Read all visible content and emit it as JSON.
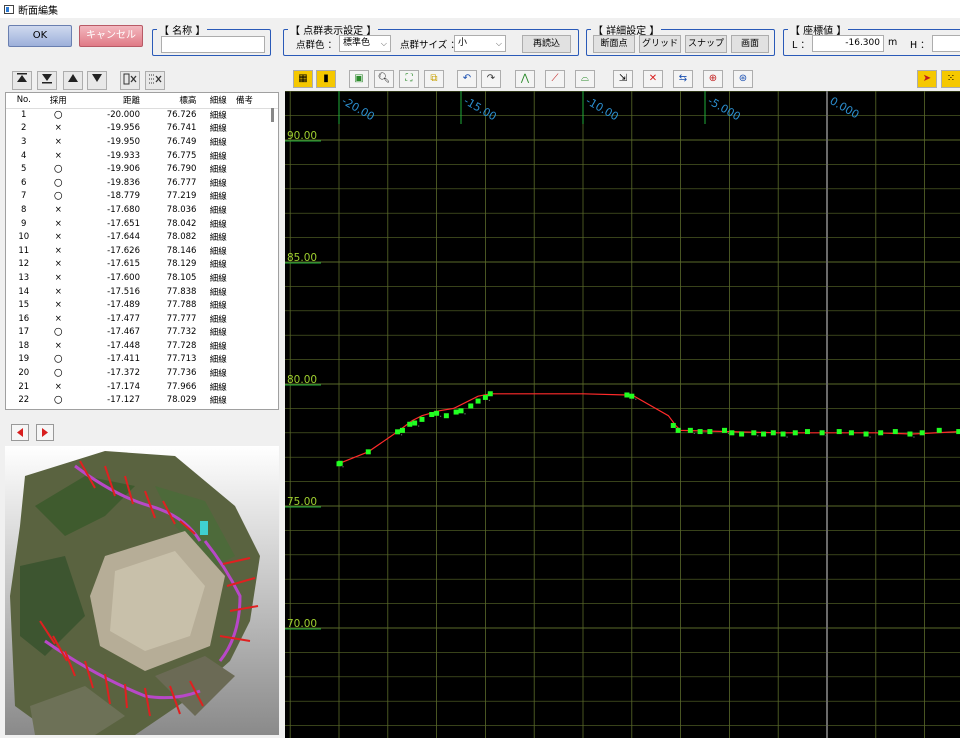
{
  "window": {
    "title": "断面編集"
  },
  "buttons": {
    "ok": "OK",
    "cancel": "キャンセル"
  },
  "name_group": {
    "title": "【 名称 】",
    "value": ""
  },
  "display_group": {
    "title": "【 点群表示設定 】",
    "color_label": "点群色 ：",
    "color_value": "標準色",
    "size_label": "点群サイズ ：",
    "size_value": "小",
    "reload": "再読込"
  },
  "detail_group": {
    "title": "【 詳細設定 】",
    "buttons": [
      "断面点",
      "グリッド",
      "スナップ",
      "画面"
    ]
  },
  "coord_group": {
    "title": "【 座標値 】",
    "l_label": "L ：",
    "l_value": "-16.300",
    "l_unit": "m",
    "h_label": "H ："
  },
  "table": {
    "headers": [
      "No.",
      "採用",
      "距離",
      "標高",
      "細線",
      "備考"
    ],
    "rows": [
      [
        "1",
        "〇",
        "-20.000",
        "76.726",
        "細線"
      ],
      [
        "2",
        "×",
        "-19.956",
        "76.741",
        "細線"
      ],
      [
        "3",
        "×",
        "-19.950",
        "76.749",
        "細線"
      ],
      [
        "4",
        "×",
        "-19.933",
        "76.775",
        "細線"
      ],
      [
        "5",
        "〇",
        "-19.906",
        "76.790",
        "細線"
      ],
      [
        "6",
        "〇",
        "-19.836",
        "76.777",
        "細線"
      ],
      [
        "7",
        "〇",
        "-18.779",
        "77.219",
        "細線"
      ],
      [
        "8",
        "×",
        "-17.680",
        "78.036",
        "細線"
      ],
      [
        "9",
        "×",
        "-17.651",
        "78.042",
        "細線"
      ],
      [
        "10",
        "×",
        "-17.644",
        "78.082",
        "細線"
      ],
      [
        "11",
        "×",
        "-17.626",
        "78.146",
        "細線"
      ],
      [
        "12",
        "×",
        "-17.615",
        "78.129",
        "細線"
      ],
      [
        "13",
        "×",
        "-17.600",
        "78.105",
        "細線"
      ],
      [
        "14",
        "×",
        "-17.516",
        "77.838",
        "細線"
      ],
      [
        "15",
        "×",
        "-17.489",
        "77.788",
        "細線"
      ],
      [
        "16",
        "×",
        "-17.477",
        "77.777",
        "細線"
      ],
      [
        "17",
        "〇",
        "-17.467",
        "77.732",
        "細線"
      ],
      [
        "18",
        "×",
        "-17.448",
        "77.728",
        "細線"
      ],
      [
        "19",
        "〇",
        "-17.411",
        "77.713",
        "細線"
      ],
      [
        "20",
        "〇",
        "-17.372",
        "77.736",
        "細線"
      ],
      [
        "21",
        "×",
        "-17.174",
        "77.966",
        "細線"
      ],
      [
        "22",
        "〇",
        "-17.127",
        "78.029",
        "細線"
      ]
    ]
  },
  "section_view": {
    "x_ticks": [
      "-20.00",
      "-15.00",
      "-10.00",
      "-5.000",
      "0.000"
    ],
    "y_ticks": [
      "90.00",
      "85.00",
      "80.00",
      "75.00",
      "70.00"
    ],
    "colors": {
      "grid": "#5a6a2a",
      "tick_label": "#2c8fd0",
      "y_label": "#9fcf2f",
      "profile": "#ff2a2a",
      "points": "#22ff22",
      "background": "#000000"
    },
    "profile": [
      [
        -20.0,
        76.73
      ],
      [
        -19.9,
        76.78
      ],
      [
        -18.8,
        77.22
      ],
      [
        -17.6,
        78.05
      ],
      [
        -17.0,
        78.5
      ],
      [
        -16.6,
        78.7
      ],
      [
        -15.9,
        78.9
      ],
      [
        -15.3,
        79.0
      ],
      [
        -14.8,
        79.25
      ],
      [
        -14.3,
        79.5
      ],
      [
        -13.8,
        79.6
      ],
      [
        -12.0,
        79.6
      ],
      [
        -10.0,
        79.6
      ],
      [
        -8.2,
        79.55
      ],
      [
        -7.9,
        79.5
      ],
      [
        -6.5,
        78.7
      ],
      [
        -6.2,
        78.3
      ],
      [
        -6.0,
        78.1
      ],
      [
        -4.0,
        78.05
      ],
      [
        -2.0,
        78.0
      ],
      [
        0.0,
        78.0
      ],
      [
        2.0,
        78.0
      ],
      [
        3.5,
        77.95
      ],
      [
        5.4,
        78.05
      ]
    ],
    "points": [
      [
        -20.0,
        76.73
      ],
      [
        -19.95,
        76.75
      ],
      [
        -18.8,
        77.22
      ],
      [
        -17.6,
        78.04
      ],
      [
        -17.4,
        78.1
      ],
      [
        -17.1,
        78.35
      ],
      [
        -16.9,
        78.4
      ],
      [
        -16.6,
        78.55
      ],
      [
        -16.2,
        78.75
      ],
      [
        -16.0,
        78.8
      ],
      [
        -15.6,
        78.7
      ],
      [
        -15.2,
        78.85
      ],
      [
        -15.0,
        78.9
      ],
      [
        -14.6,
        79.1
      ],
      [
        -14.3,
        79.3
      ],
      [
        -14.0,
        79.45
      ],
      [
        -13.8,
        79.6
      ],
      [
        -8.2,
        79.55
      ],
      [
        -8.0,
        79.5
      ],
      [
        -6.3,
        78.3
      ],
      [
        -6.1,
        78.1
      ],
      [
        -5.6,
        78.1
      ],
      [
        -5.2,
        78.05
      ],
      [
        -4.8,
        78.05
      ],
      [
        -4.2,
        78.1
      ],
      [
        -3.9,
        78.0
      ],
      [
        -3.5,
        77.95
      ],
      [
        -3.0,
        78.0
      ],
      [
        -2.6,
        77.95
      ],
      [
        -2.2,
        78.0
      ],
      [
        -1.8,
        77.95
      ],
      [
        -1.3,
        78.0
      ],
      [
        -0.8,
        78.05
      ],
      [
        -0.2,
        78.0
      ],
      [
        0.5,
        78.05
      ],
      [
        1.0,
        78.0
      ],
      [
        1.6,
        77.95
      ],
      [
        2.2,
        78.0
      ],
      [
        2.8,
        78.05
      ],
      [
        3.4,
        77.95
      ],
      [
        3.9,
        78.0
      ],
      [
        4.6,
        78.1
      ],
      [
        5.4,
        78.05
      ]
    ]
  },
  "icons": [
    "move-top-icon",
    "move-down-icon",
    "move-up-icon",
    "move-bottom-icon",
    "delete-point-icon",
    "delete-rows-icon"
  ]
}
